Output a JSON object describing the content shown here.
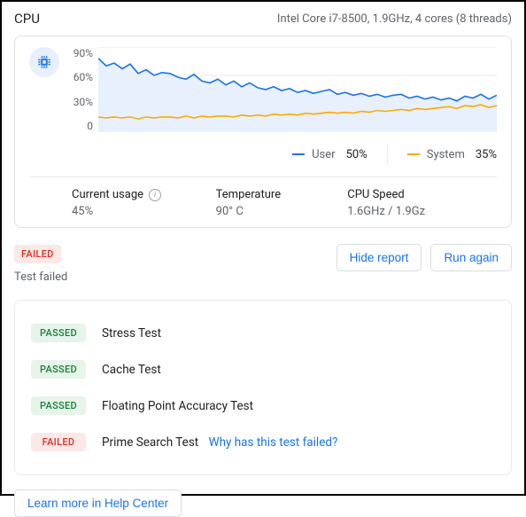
{
  "header": {
    "title": "CPU",
    "spec": "Intel Core i7-8500, 1.9GHz, 4 cores (8 threads)"
  },
  "chart_data": {
    "type": "line",
    "ylim": [
      0,
      90
    ],
    "yticks": [
      "90%",
      "60%",
      "30%",
      "0"
    ],
    "x": [
      0,
      2,
      4,
      6,
      8,
      10,
      12,
      14,
      16,
      18,
      20,
      22,
      24,
      26,
      28,
      30,
      32,
      34,
      36,
      38,
      40,
      42,
      44,
      46,
      48,
      50,
      52,
      54,
      56,
      58,
      60,
      62,
      64,
      66,
      68,
      70,
      72,
      74,
      76,
      78,
      80,
      82,
      84,
      86,
      88,
      90,
      92,
      94,
      96,
      98,
      100
    ],
    "series": [
      {
        "name": "User",
        "color": "#1a73e8",
        "current": "50%",
        "values": [
          78,
          70,
          73,
          67,
          72,
          62,
          66,
          60,
          63,
          62,
          58,
          56,
          61,
          54,
          52,
          56,
          50,
          54,
          48,
          52,
          47,
          45,
          48,
          44,
          46,
          42,
          44,
          41,
          43,
          45,
          40,
          42,
          39,
          41,
          38,
          40,
          37,
          39,
          40,
          36,
          38,
          35,
          37,
          34,
          36,
          33,
          38,
          36,
          40,
          35,
          39
        ]
      },
      {
        "name": "System",
        "color": "#f9ab00",
        "current": "35%",
        "values": [
          16,
          15,
          16,
          15,
          16,
          14,
          16,
          15,
          16,
          16,
          15,
          17,
          15,
          17,
          16,
          17,
          17,
          16,
          18,
          17,
          18,
          17,
          19,
          18,
          19,
          18,
          20,
          19,
          20,
          21,
          20,
          21,
          20,
          22,
          21,
          23,
          22,
          23,
          24,
          23,
          25,
          24,
          25,
          26,
          27,
          25,
          28,
          27,
          29,
          26,
          28
        ]
      }
    ]
  },
  "stats": {
    "current_label": "Current usage",
    "current_value": "45%",
    "temp_label": "Temperature",
    "temp_value": "90° C",
    "speed_label": "CPU Speed",
    "speed_value": "1.6GHz / 1.9Gz"
  },
  "result": {
    "overall_badge": "FAILED",
    "overall_msg": "Test failed",
    "hide_report": "Hide report",
    "run_again": "Run again",
    "passed_label": "PASSED",
    "failed_label": "FAILED",
    "tests": {
      "t1": "Stress Test",
      "t2": "Cache Test",
      "t3": "Floating Point Accuracy Test",
      "t4": "Prime Search Test"
    },
    "why_link": "Why has this test failed?"
  },
  "footer": {
    "learn_more": "Learn more in Help Center"
  }
}
